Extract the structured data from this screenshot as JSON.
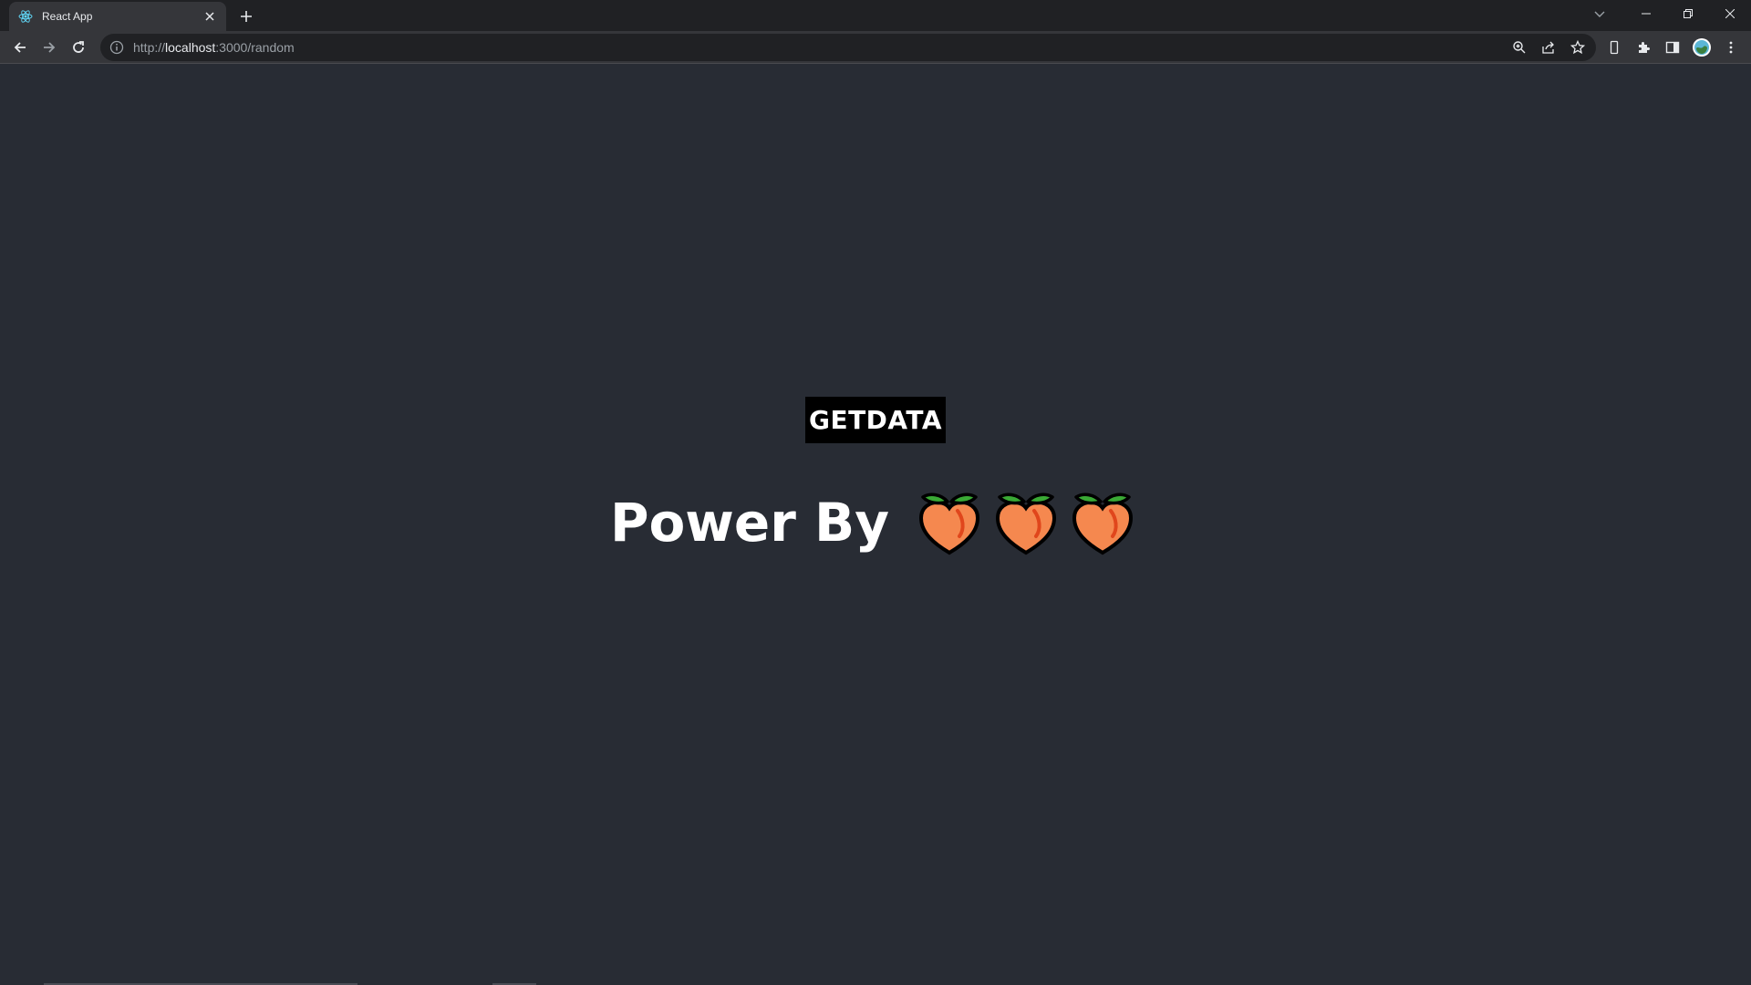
{
  "browser": {
    "tab": {
      "title": "React App",
      "favicon": "react-icon"
    },
    "url": {
      "scheme": "http://",
      "host": "localhost",
      "rest": ":3000/random"
    }
  },
  "page": {
    "button_label": "GETDATA",
    "power_text": "Power By",
    "emoji": [
      "peach",
      "peach",
      "peach"
    ]
  },
  "colors": {
    "page_background": "#282c34",
    "button_background": "#000000",
    "text": "#ffffff"
  }
}
